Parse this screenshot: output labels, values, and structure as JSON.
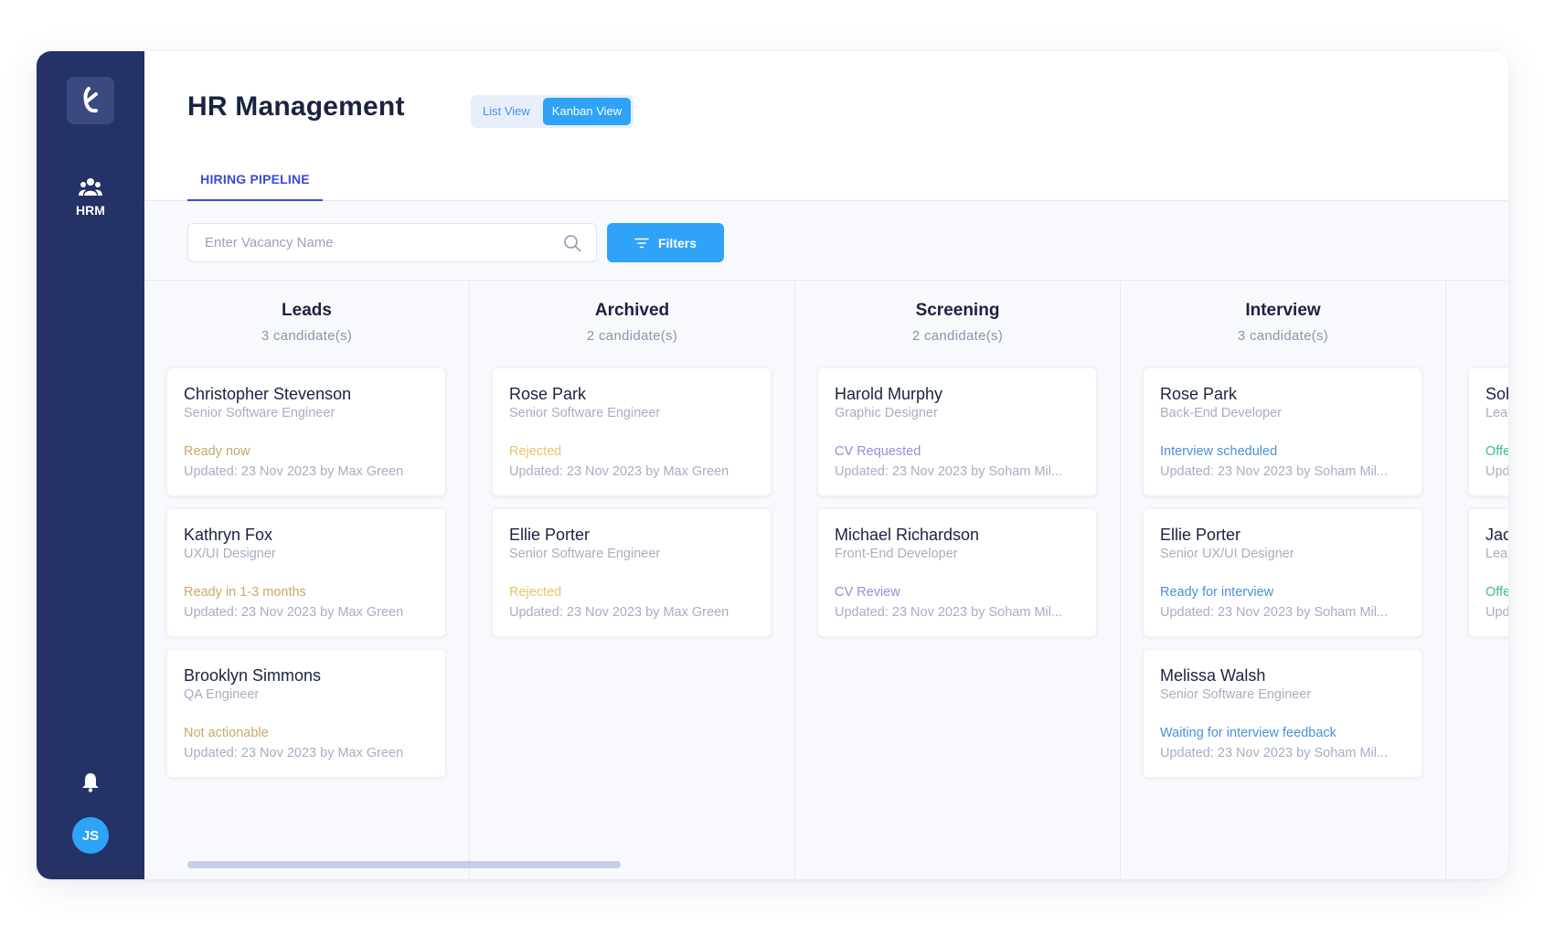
{
  "sidebar": {
    "logo_icon": "brand-logo",
    "nav": [
      {
        "label": "HRM",
        "icon": "team-icon"
      }
    ],
    "bell_icon": "bell-icon",
    "avatar_initials": "JS"
  },
  "header": {
    "title": "HR Management",
    "view_toggle": [
      "List View",
      "Kanban View"
    ],
    "active_view": "Kanban View",
    "tab": "HIRING PIPELINE"
  },
  "toolbar": {
    "search_placeholder": "Enter Vacancy Name",
    "filters_label": "Filters"
  },
  "colors": {
    "sidebar": "#243266",
    "accent": "#2ea3f7",
    "tab_active": "#3b49d8",
    "status_leads": "#c8a96a",
    "status_archived": "#e9c46a",
    "status_screening": "#9b8ad8",
    "status_interview": "#4a90d9",
    "status_offer": "#3dbb8a"
  },
  "columns": [
    {
      "title": "Leads",
      "count": "3 candidate(s)",
      "status_color": "#c8a96a",
      "cards": [
        {
          "name": "Christopher Stevenson",
          "role": "Senior Software Engineer",
          "status": "Ready now",
          "updated": "Updated: 23 Nov 2023 by Max Green"
        },
        {
          "name": "Kathryn Fox",
          "role": "UX/UI Designer",
          "status": "Ready in 1-3 months",
          "updated": "Updated: 23 Nov 2023 by Max Green"
        },
        {
          "name": "Brooklyn Simmons",
          "role": "QA Engineer",
          "status": "Not actionable",
          "updated": "Updated: 23 Nov 2023 by Max Green"
        }
      ]
    },
    {
      "title": "Archived",
      "count": "2 candidate(s)",
      "status_color": "#e9c46a",
      "cards": [
        {
          "name": "Rose Park",
          "role": "Senior Software Engineer",
          "status": "Rejected",
          "updated": "Updated: 23 Nov 2023 by Max Green"
        },
        {
          "name": "Ellie Porter",
          "role": "Senior Software Engineer",
          "status": "Rejected",
          "updated": "Updated: 23 Nov 2023 by Max Green"
        }
      ]
    },
    {
      "title": "Screening",
      "count": "2 candidate(s)",
      "status_color": "#9b8ad8",
      "cards": [
        {
          "name": "Harold Murphy",
          "role": "Graphic Designer",
          "status": "CV Requested",
          "updated": "Updated: 23 Nov 2023 by Soham Mil..."
        },
        {
          "name": "Michael Richardson",
          "role": "Front-End Developer",
          "status": "CV Review",
          "updated": "Updated: 23 Nov 2023 by Soham Mil..."
        }
      ]
    },
    {
      "title": "Interview",
      "count": "3 candidate(s)",
      "status_color": "#4a90d9",
      "cards": [
        {
          "name": "Rose Park",
          "role": "Back-End Developer",
          "status": "Interview scheduled",
          "updated": "Updated: 23 Nov 2023 by Soham Mil..."
        },
        {
          "name": "Ellie Porter",
          "role": "Senior UX/UI Designer",
          "status": "Ready for interview",
          "updated": "Updated: 23 Nov 2023 by Soham Mil..."
        },
        {
          "name": "Melissa Walsh",
          "role": "Senior Software Engineer",
          "status": "Waiting for interview feedback",
          "updated": "Updated: 23 Nov 2023 by Soham Mil..."
        }
      ]
    },
    {
      "title": "",
      "count": "",
      "status_color": "#3dbb8a",
      "cards": [
        {
          "name": "Soh",
          "role": "Leac",
          "status": "Offe",
          "updated": "Upd"
        },
        {
          "name": "Jac",
          "role": "Leac",
          "status": "Offe",
          "updated": "Upd"
        }
      ]
    }
  ]
}
